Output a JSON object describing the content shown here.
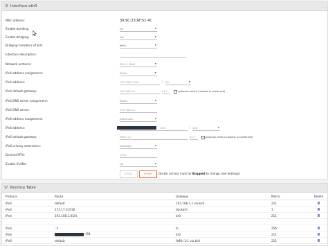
{
  "interface": {
    "title": "Interface eth0",
    "mac_label": "MAC address:",
    "mac_value": "30:9C:23:AF:51:4C",
    "bonding_label": "Enable bonding:",
    "bonding_value": "No",
    "bridging_label": "Enable bridging:",
    "bridging_value": "Yes",
    "bridge_members_label": "Bridging members of br0:",
    "bridge_members_value": "eth0",
    "description_label": "Interface description:",
    "protocol_label": "Network protocol:",
    "protocol_value": "IPv4 + IPv6",
    "ipv4_assign_label": "IPv4 address assignment:",
    "ipv4_assign_value": "Static",
    "ipv4_addr_label": "IPv4 address:",
    "ipv4_addr_value": "192.168.1.205",
    "ipv4_mask_value": "24",
    "ipv4_gw_label": "IPv4 default gateway:",
    "ipv4_gw_value": "192.168.1.1",
    "ipv4_metric_value": "211",
    "ipv4_metric_note": "optional metric (lowest is preferred)",
    "ipv4_dns_assign_label": "IPv4 DNS server assignment:",
    "ipv4_dns_assign_value": "Static",
    "ipv4_dns_label": "IPv4 DNS server:",
    "ipv4_dns_value": "192.168.1.1",
    "ipv6_assign_label": "IPv6 address assignment:",
    "ipv6_assign_value": "Automatic",
    "ipv6_addr_label": "IPv6 address:",
    "ipv6_addr_suffix": ":1394",
    "ipv6_prefix_value": "128",
    "ipv6_gw_label": "IPv6 default gateway:",
    "ipv6_gw_value": "fe80::1:1",
    "ipv6_metric_value": "211",
    "ipv6_metric_note": "optional metric (lowest is preferred)",
    "ipv6_privacy_label": "IPv6 privacy extensions:",
    "ipv6_privacy_value": "Disabled",
    "mtu_label": "Desired MTU:",
    "mtu_value": "1500",
    "vlans_label": "Enable VLANs:",
    "vlans_value": "No",
    "apply_label": "APPLY",
    "done_label": "DONE",
    "stopped_pre": "Docker service must be ",
    "stopped_bold": "Stopped",
    "stopped_post": " to change (see Settings)"
  },
  "routing": {
    "title": "Routing Table",
    "columns": [
      "Protocol",
      "Route",
      "Gateway",
      "Metric",
      "Delete"
    ],
    "rows_v4": [
      {
        "protocol": "IPv4",
        "route": "default",
        "gateway": "192.168.1.1 via br0",
        "metric": "211"
      },
      {
        "protocol": "IPv4",
        "route": "172.17.0.0/16",
        "gateway": "docker0",
        "metric": "1"
      },
      {
        "protocol": "IPv4",
        "route": "192.168.1.0/24",
        "gateway": "br0",
        "metric": "211"
      }
    ],
    "rows_v6": [
      {
        "protocol": "IPv6",
        "route": "::1",
        "gateway": "lo",
        "metric": "256"
      },
      {
        "protocol": "IPv6",
        "route": "::/64",
        "gateway": "br0",
        "metric": "211"
      },
      {
        "protocol": "IPv6",
        "route": "default",
        "gateway": "fe80::1:1 via br0",
        "metric": "211"
      }
    ]
  },
  "icons": {
    "panel": "gear-icon",
    "routing": "branch-icon",
    "dropdown": "chevron-down-icon",
    "delete": "trash-icon",
    "cursor": "mouse-pointer-icon"
  },
  "colors": {
    "done_accent": "#e06a3b",
    "redaction": "#2a3340",
    "delete_icon": "#7b89c6"
  }
}
